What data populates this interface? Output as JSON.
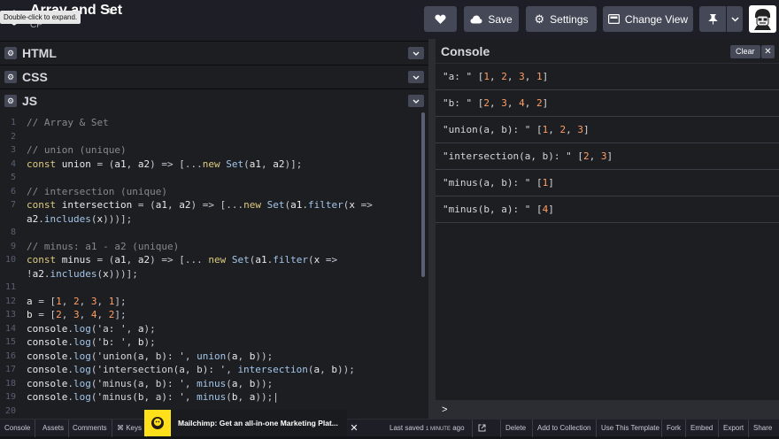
{
  "header": {
    "title": "Array and Set",
    "owner": "CP",
    "tooltip": "Double-click to expand.",
    "buttons": {
      "save": "Save",
      "settings": "Settings",
      "change_view": "Change View"
    }
  },
  "panels": {
    "html": "HTML",
    "css": "CSS",
    "js": "JS"
  },
  "editor": {
    "line_numbers": [
      "1",
      "2",
      "3",
      "4",
      "5",
      "6",
      "7",
      "",
      "8",
      "9",
      "10",
      "",
      "11",
      "12",
      "13",
      "14",
      "15",
      "16",
      "17",
      "18",
      "19",
      "20"
    ]
  },
  "console": {
    "title": "Console",
    "clear": "Clear",
    "close": "✕",
    "rows": [
      {
        "label": "\"a: \"",
        "values": [
          "1",
          "2",
          "3",
          "1"
        ]
      },
      {
        "label": "\"b: \"",
        "values": [
          "2",
          "3",
          "4",
          "2"
        ]
      },
      {
        "label": "\"union(a, b): \"",
        "values": [
          "1",
          "2",
          "3"
        ]
      },
      {
        "label": "\"intersection(a, b): \"",
        "values": [
          "2",
          "3"
        ]
      },
      {
        "label": "\"minus(a, b): \"",
        "values": [
          "1"
        ]
      },
      {
        "label": "\"minus(b, a): \"",
        "values": [
          "4"
        ]
      }
    ],
    "prompt": ">"
  },
  "footer": {
    "tabs": [
      "Console",
      "Assets",
      "Comments",
      "⌘ Keys"
    ],
    "ad_text": "Mailchimp: Get an all-in-one Marketing Plat...",
    "ad_close": "✕",
    "saved_prefix": "Last saved",
    "saved_time": "1 minute",
    "saved_suffix": "ago",
    "buttons": [
      "Delete",
      "Add to Collection",
      "Use This Template",
      "Fork",
      "Embed",
      "Export",
      "Share"
    ]
  }
}
